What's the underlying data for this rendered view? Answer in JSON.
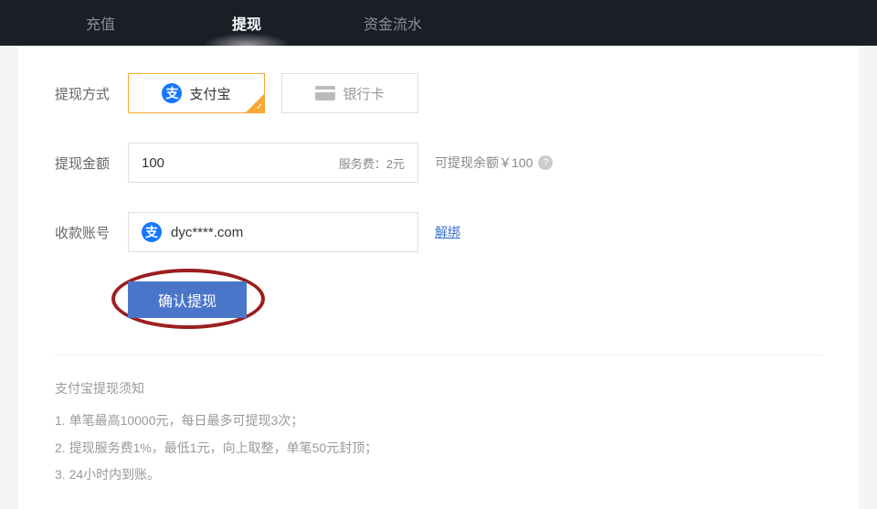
{
  "tabs": {
    "recharge": "充值",
    "withdraw": "提现",
    "flow": "资金流水"
  },
  "form": {
    "method_label": "提现方式",
    "method_alipay": "支付宝",
    "method_bank": "银行卡",
    "amount_label": "提现金额",
    "amount_value": "100",
    "fee": "服务费：2元",
    "balance": "可提现余额￥100",
    "account_label": "收款账号",
    "account_value": "dyc****.com",
    "unbind": "解绑",
    "submit": "确认提现",
    "alipay_glyph": "支"
  },
  "notice": {
    "title": "支付宝提现须知",
    "line1": "1. 单笔最高10000元，每日最多可提现3次；",
    "line2": "2. 提现服务费1%，最低1元，向上取整，单笔50元封顶；",
    "line3": "3. 24小时内到账。"
  }
}
